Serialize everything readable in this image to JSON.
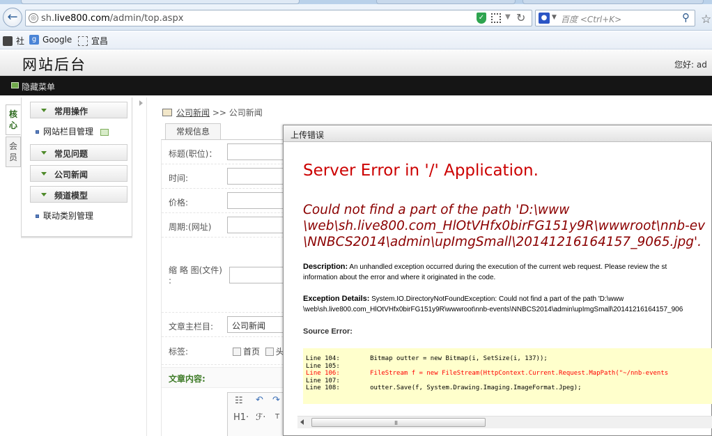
{
  "browser": {
    "url_prefix": "sh.",
    "url_domain": "live800.com",
    "url_path": "/admin/top.aspx",
    "search_placeholder": "百度 <Ctrl+K>",
    "bookmarks": [
      "社",
      "Google",
      "宜昌"
    ],
    "icons": [
      "back-arrow-icon",
      "globe-icon",
      "shield-icon",
      "qr-code-icon",
      "reload-icon",
      "paw-icon",
      "magnifier-icon",
      "star-icon"
    ]
  },
  "app": {
    "title": "网站后台",
    "greeting": "您好: ad",
    "hide_menu": "隐藏菜单"
  },
  "sidebar": {
    "vtabs": [
      "核心",
      "会员"
    ],
    "groups": [
      {
        "label": "常用操作",
        "items": [
          "网站栏目管理"
        ]
      },
      {
        "label": "常见问题",
        "items": []
      },
      {
        "label": "公司新闻",
        "items": []
      },
      {
        "label": "频道模型",
        "items": [
          "联动类别管理"
        ]
      }
    ]
  },
  "breadcrumb": {
    "link": "公司新闻",
    "sep": ">>",
    "current": "公司新闻"
  },
  "form": {
    "tab": "常规信息",
    "fields": {
      "title": "标题(职位)：",
      "time": "时间:",
      "price": "价格:",
      "period": "周期:(网址)",
      "thumb_line1": "缩 略 图(文件)",
      "thumb_line2": ":",
      "category": "文章主栏目:",
      "category_value": "公司新闻",
      "tags": "标签:",
      "tag_home": "首页",
      "tag_head": "头"
    },
    "content_label": "文章内容:",
    "editor_tools": [
      "H1·",
      "ℱ·",
      "T"
    ]
  },
  "dialog": {
    "title": "上传错误",
    "heading": "Server Error in '/' Application.",
    "message_lines": [
      "Could not find a part of the path 'D:\\www",
      "\\web\\sh.live800.com_HlOtVHfx0birFG151y9R\\wwwroot\\nnb-ev",
      "\\NNBCS2014\\admin\\upImgSmall\\20141216164157_9065.jpg'."
    ],
    "description_label": "Description:",
    "description_line1": "An unhandled exception occurred during the execution of the current web request. Please review the st",
    "description_line2": "information about the error and where it originated in the code.",
    "exception_label": "Exception Details:",
    "exception_line1": "System.IO.DirectoryNotFoundException: Could not find a part of the path 'D:\\www",
    "exception_line2": "\\web\\sh.live800.com_HlOtVHfx0birFG151y9R\\wwwroot\\nnb-events\\NNBCS2014\\admin\\upImgSmall\\20141216164157_906",
    "source_label": "Source Error:",
    "code_lines": [
      {
        "text": "Line 104:        Bitmap outter = new Bitmap(i, SetSize(i, 137));",
        "highlight": false
      },
      {
        "text": "Line 105:",
        "highlight": false
      },
      {
        "text": "Line 106:        FileStream f = new FileStream(HttpContext.Current.Request.MapPath(\"~/nnb-events",
        "highlight": true
      },
      {
        "text": "Line 107:",
        "highlight": false
      },
      {
        "text": "Line 108:        outter.Save(f, System.Drawing.Imaging.ImageFormat.Jpeg);",
        "highlight": false
      }
    ],
    "scroll_grip": "III"
  },
  "colors": {
    "error_red": "#cc0000",
    "error_darkred": "#8b0000",
    "code_bg": "#ffffcc",
    "sidebar_accent": "#4e8a2a",
    "topbar": "#151515"
  }
}
